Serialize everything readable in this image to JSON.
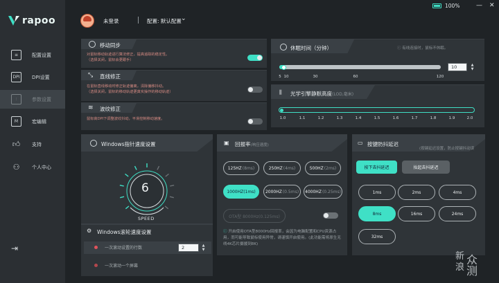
{
  "brand": {
    "name": "rapoo"
  },
  "sidebar": {
    "items": [
      {
        "label": "配置设置",
        "icon": "settings-sliders-icon"
      },
      {
        "label": "DPI设置",
        "icon": "dpi-icon"
      },
      {
        "label": "参数设置",
        "icon": "parameter-icon"
      },
      {
        "label": "宏编辑",
        "icon": "macro-icon"
      },
      {
        "label": "支持",
        "icon": "thumbs-up-icon"
      },
      {
        "label": "个人中心",
        "icon": "user-icon"
      }
    ],
    "active_index": 2
  },
  "topbar": {
    "login_status": "未登录",
    "profile": "配置: 默认配置",
    "battery": "100%"
  },
  "motion_sync": {
    "title": "移动同步",
    "desc1": "对鼠标移动轨迹进行算法修正，提高追踪的稳定性。",
    "desc2": "（选择关闭，鼠标会更跟手）",
    "enabled": true
  },
  "angle_snap": {
    "title": "直线修正",
    "desc1": "在鼠标直线移动时修正轨迹偏离，清除偏移抖动。",
    "desc2": "（选择关闭，鼠标的移动轨迹更真实操作的移动轨迹）",
    "enabled": false
  },
  "ripple_control": {
    "title": "波纹修正",
    "desc1": "鼠标高DPI下调整波纹抖动，平滑控制移动速度。",
    "enabled": false
  },
  "sleep": {
    "title": "休眠时间（分钟）",
    "hint": "有线连接时，鼠标不休眠。",
    "value": "10",
    "ticks": [
      "5",
      "10",
      "30",
      "60",
      "120"
    ]
  },
  "lod": {
    "title": "光学引擎静默高度",
    "title_suffix": "(LOD,毫米)",
    "ticks": [
      "1.0",
      "1.1",
      "1.2",
      "1.3",
      "1.4",
      "1.5",
      "1.6",
      "1.7",
      "1.8",
      "1.9",
      "2.0"
    ],
    "value": 1.0
  },
  "pointer_speed": {
    "title": "Windows指针速度设置",
    "value": "6",
    "label": "SPEED",
    "level": 6
  },
  "scroll_speed": {
    "title": "Windows滚轮速度设置",
    "option1": "一次滚动设置的行数",
    "option1_value": "2",
    "option2": "一次滚动一个屏幕"
  },
  "polling": {
    "title": "回报率",
    "title_sub": "(响应速度)",
    "rates": [
      {
        "main": "125HZ",
        "sub": "(8ms)"
      },
      {
        "main": "250HZ",
        "sub": "(4ms)"
      },
      {
        "main": "500HZ",
        "sub": "(2ms)"
      },
      {
        "main": "1000HZ(1ms)",
        "sub": ""
      },
      {
        "main": "2000HZ",
        "sub": "(0.5ms)"
      },
      {
        "main": "4000HZ",
        "sub": "(0.25ms)"
      }
    ],
    "selected_index": 3,
    "ota_label": "OTA型 8000Hz(0.125ms)",
    "note": "开启使用OTA型8000Hz回报率，会因为电脑配置和CPU资源占用，而可能导致鼠标使用异常，请谨慎开启使用。(此功能需将原生无线4K芯片摄援到8K)"
  },
  "debounce": {
    "title": "按键防抖延迟",
    "hint": "(按键延迟设置，防止按键抖动误",
    "tab_press": "按下去抖延迟",
    "tab_release": "抬起去抖延迟",
    "options": [
      "1ms",
      "2ms",
      "4ms",
      "8ms",
      "16ms",
      "24ms",
      "32ms"
    ],
    "selected_index": 3
  },
  "watermark": {
    "line1": "新",
    "line2": "浪",
    "line3": "众测"
  },
  "colors": {
    "accent": "#3fe0c6",
    "panel": "#2f3438",
    "background": "#1f2326",
    "warn_text": "#d58a82"
  }
}
